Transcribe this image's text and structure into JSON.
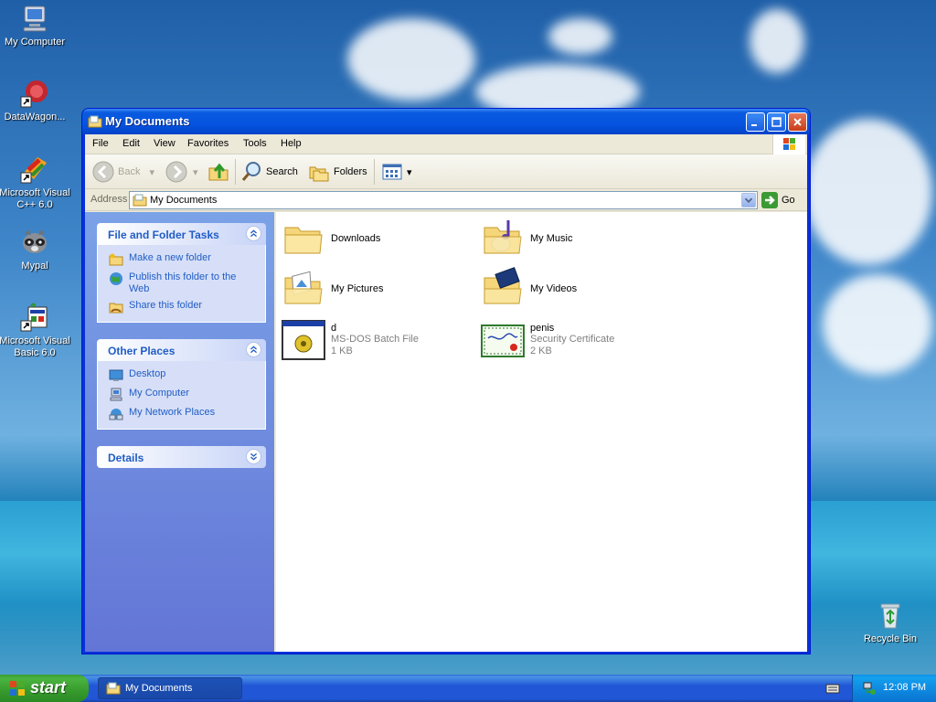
{
  "desktop": {
    "icons": [
      {
        "label": "My Computer"
      },
      {
        "label": "DataWagon..."
      },
      {
        "label": "Microsoft Visual C++ 6.0"
      },
      {
        "label": "Mypal"
      },
      {
        "label": "Microsoft Visual Basic 6.0"
      },
      {
        "label": "Recycle Bin"
      }
    ]
  },
  "window": {
    "title": "My Documents",
    "menu": [
      "File",
      "Edit",
      "View",
      "Favorites",
      "Tools",
      "Help"
    ],
    "toolbar": {
      "back": "Back",
      "search": "Search",
      "folders": "Folders"
    },
    "address": {
      "label": "Address",
      "value": "My Documents",
      "go": "Go"
    },
    "taskpane": {
      "file_tasks": {
        "title": "File and Folder Tasks",
        "links": [
          "Make a new folder",
          "Publish this folder to the Web",
          "Share this folder"
        ]
      },
      "other_places": {
        "title": "Other Places",
        "links": [
          "Desktop",
          "My Computer",
          "My Network Places"
        ]
      },
      "details": {
        "title": "Details"
      }
    },
    "items": [
      {
        "name": "Downloads"
      },
      {
        "name": "My Music"
      },
      {
        "name": "My Pictures"
      },
      {
        "name": "My Videos"
      },
      {
        "name": "d",
        "type": "MS-DOS Batch File",
        "size": "1 KB"
      },
      {
        "name": "penis",
        "type": "Security Certificate",
        "size": "2 KB"
      }
    ]
  },
  "taskbar": {
    "start": "start",
    "task": "My Documents",
    "clock": "12:08 PM"
  },
  "colors": {
    "titlebar": "#0554e0",
    "link": "#215dc6",
    "start": "#379a2d"
  }
}
